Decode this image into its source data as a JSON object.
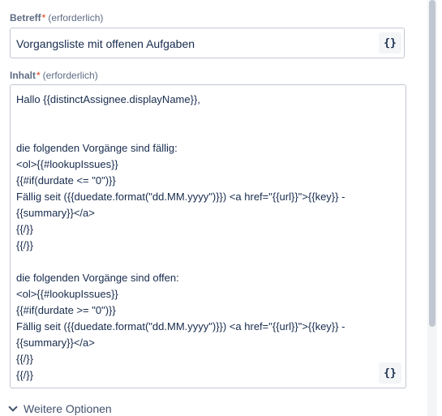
{
  "subject": {
    "label": "Betreff",
    "required_mark": "*",
    "required_note": "(erforderlich)",
    "value": "Vorgangsliste mit offenen Aufgaben",
    "smart_value_button": "{}"
  },
  "content": {
    "label": "Inhalt",
    "required_mark": "*",
    "required_note": "(erforderlich)",
    "lines": [
      "Hallo {{distinctAssignee.displayName}},",
      "",
      "",
      "die folgenden Vorgänge sind fällig:",
      "<ol>{{#lookupIssues}}",
      "{{#if(durdate <= \"0\")}}",
      "Fällig seit ({{duedate.format(\"dd.MM.yyyy\")}}) <a href=\"{{url}}\">{{key}} -",
      "{{summary}}</a>",
      "{{/}}",
      "{{/}}",
      "",
      "die folgenden Vorgänge sind offen:",
      "<ol>{{#lookupIssues}}",
      "{{#if(durdate >= \"0\")}}",
      "Fällig seit ({{duedate.format(\"dd.MM.yyyy\")}}) <a href=\"{{url}}\">{{key}} -",
      "{{summary}}</a>",
      "{{/}}",
      "{{/}}"
    ],
    "smart_value_button": "{}"
  },
  "more_options": {
    "label": "Weitere Optionen",
    "icon": "chevron-down-icon"
  }
}
